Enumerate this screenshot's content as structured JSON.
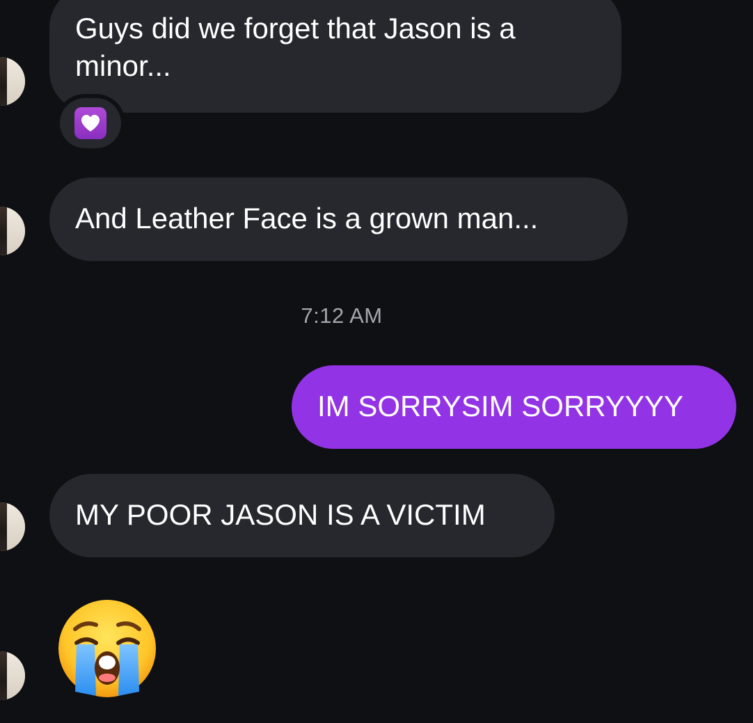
{
  "messages": [
    {
      "sender": "other",
      "text": "Guys did we forget that Jason is a minor...",
      "reaction": "heart"
    },
    {
      "sender": "other",
      "text": "And Leather Face is a grown man..."
    },
    {
      "sender": "me",
      "text": "IM SORRYSIM SORRYYYY"
    },
    {
      "sender": "other",
      "text": "MY POOR JASON IS A VICTIM"
    },
    {
      "sender": "other",
      "emoji": "loudly-crying-face"
    }
  ],
  "timestamp": "7:12 AM",
  "colors": {
    "background": "#0e1014",
    "incoming_bubble": "#26282e",
    "outgoing_bubble": "#9333e6",
    "timestamp_text": "#a4a7ad",
    "reaction_heart": "#a03fd0"
  }
}
